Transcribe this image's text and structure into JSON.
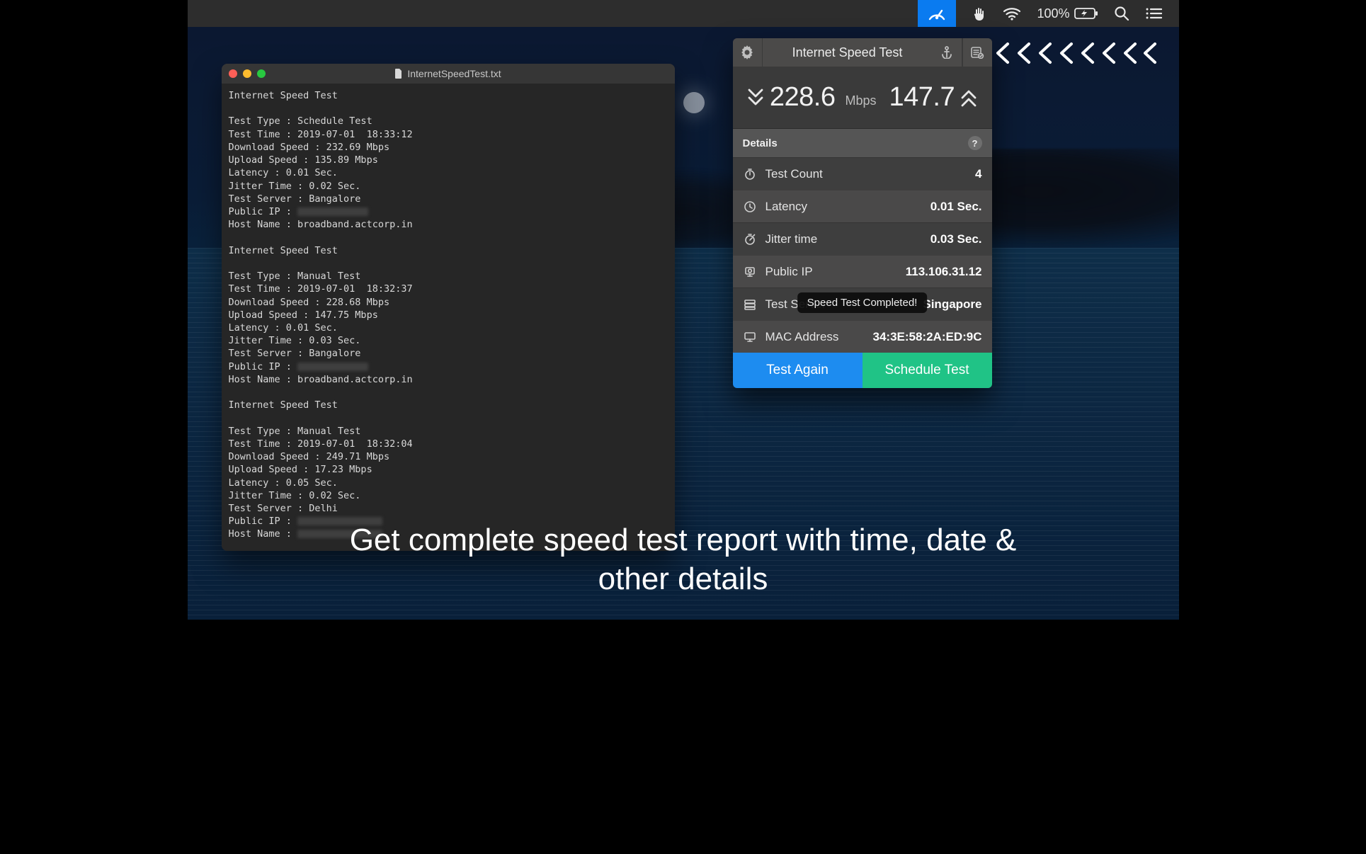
{
  "menubar": {
    "battery_text": "100%"
  },
  "editor": {
    "filename": "InternetSpeedTest.txt",
    "blocks": [
      {
        "title": "Internet Speed Test",
        "lines": [
          "Test Type : Schedule Test",
          "Test Time : 2019-07-01  18:33:12",
          "Download Speed : 232.69 Mbps",
          "Upload Speed : 135.89 Mbps",
          "Latency : 0.01 Sec.",
          "Jitter Time : 0.02 Sec.",
          "Test Server : Bangalore",
          "Public IP : ",
          "Host Name : broadband.actcorp.in"
        ],
        "redact_line_index": 7,
        "redact_width": 100
      },
      {
        "title": "Internet Speed Test",
        "lines": [
          "Test Type : Manual Test",
          "Test Time : 2019-07-01  18:32:37",
          "Download Speed : 228.68 Mbps",
          "Upload Speed : 147.75 Mbps",
          "Latency : 0.01 Sec.",
          "Jitter Time : 0.03 Sec.",
          "Test Server : Bangalore",
          "Public IP : ",
          "Host Name : broadband.actcorp.in"
        ],
        "redact_line_index": 7,
        "redact_width": 100
      },
      {
        "title": "Internet Speed Test",
        "lines": [
          "Test Type : Manual Test",
          "Test Time : 2019-07-01  18:32:04",
          "Download Speed : 249.71 Mbps",
          "Upload Speed : 17.23 Mbps",
          "Latency : 0.05 Sec.",
          "Jitter Time : 0.02 Sec.",
          "Test Server : Delhi",
          "Public IP : ",
          "Host Name : "
        ],
        "redact_line_index": 7,
        "redact_width": 120,
        "redact_line_index2": 8,
        "redact_width2": 120
      }
    ]
  },
  "panel": {
    "title": "Internet Speed Test",
    "download": "228.6",
    "upload": "147.7",
    "unit": "Mbps",
    "details_label": "Details",
    "rows": [
      {
        "icon": "stopwatch",
        "label": "Test Count",
        "value": "4",
        "tone": "dark"
      },
      {
        "icon": "clock",
        "label": "Latency",
        "value": "0.01 Sec.",
        "tone": "mid"
      },
      {
        "icon": "timer",
        "label": "Jitter time",
        "value": "0.03 Sec.",
        "tone": "dark"
      },
      {
        "icon": "ip",
        "label": "Public IP",
        "value": "113.106.31.12",
        "tone": "mid"
      },
      {
        "icon": "server",
        "label": "Test Server",
        "value": "Singapore",
        "tone": "dark",
        "toast": "Speed Test Completed!"
      },
      {
        "icon": "monitor",
        "label": "MAC Address",
        "value": "34:3E:58:2A:ED:9C",
        "tone": "mid"
      }
    ],
    "btn_test": "Test Again",
    "btn_schedule": "Schedule Test"
  },
  "caption_line1": "Get complete speed test report with time, date &",
  "caption_line2": "other details"
}
